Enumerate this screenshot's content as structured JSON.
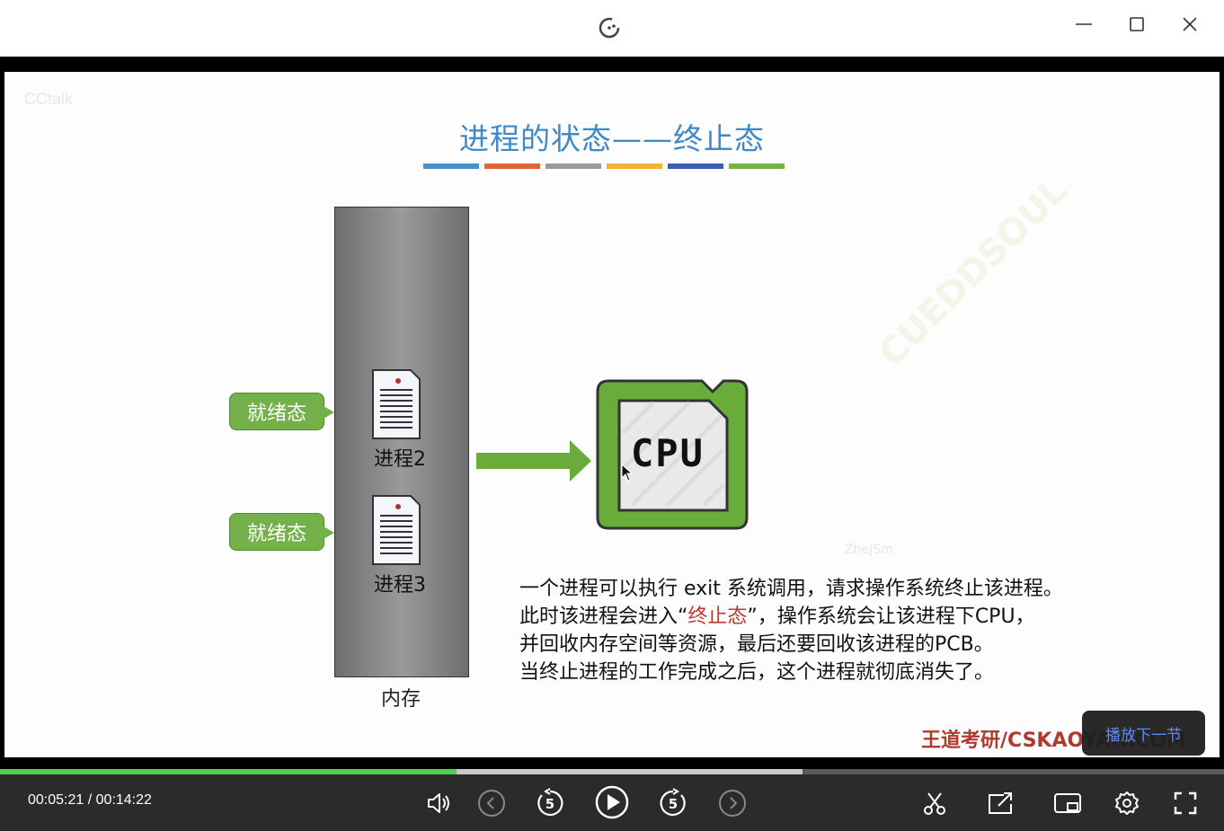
{
  "window": {
    "minimize_icon": "minimize-icon",
    "maximize_icon": "maximize-icon",
    "close_icon": "close-icon"
  },
  "slide": {
    "watermark": "CCtalk",
    "title": "进程的状态——终止态",
    "stripe_colors": [
      "#4a90c8",
      "#e0643a",
      "#9a9a9a",
      "#f2b233",
      "#3a5fad",
      "#78b246"
    ],
    "memory_label": "内存",
    "processes": [
      {
        "label": "进程2",
        "state": "就绪态"
      },
      {
        "label": "进程3",
        "state": "就绪态"
      }
    ],
    "cpu_label": "CPU",
    "wm_name": "ZheJSm",
    "wm_green": "CUEDDSOUL",
    "description": {
      "line1": "一个进程可以执行 exit 系统调用，请求操作系统终止该进程。",
      "line2_pre": "此时该进程会进入“",
      "line2_red": "终止态",
      "line2_post": "”，操作系统会让该进程下CPU，",
      "line3": "并回收内存空间等资源，最后还要回收该进程的PCB。",
      "line4": "当终止进程的工作完成之后，这个进程就彻底消失了。"
    },
    "brand": "王道考研/CSKAOYAN.COM"
  },
  "player": {
    "next_label": "播放下一节",
    "current_time": "00:05:21",
    "separator": "/",
    "total_time": "00:14:22",
    "played_fraction": 0.373,
    "buffered_fraction": 0.656,
    "played_color": "#4fd14f"
  }
}
